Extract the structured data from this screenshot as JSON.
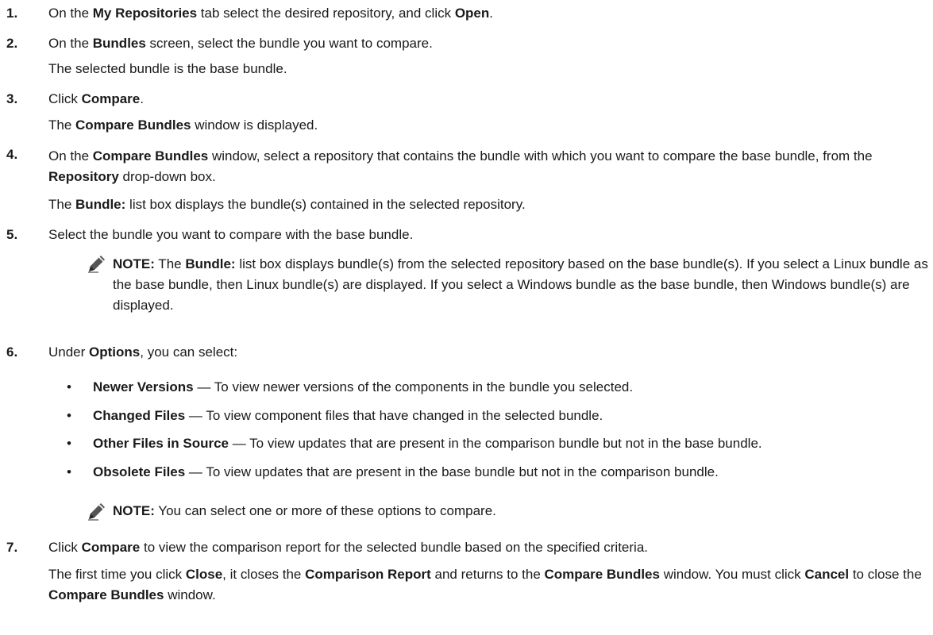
{
  "steps": [
    {
      "num": "1.",
      "parts": [
        "On the ",
        "My Repositories",
        " tab select the desired repository, and click ",
        "Open",
        "."
      ]
    },
    {
      "num": "2.",
      "parts": [
        "On the ",
        "Bundles",
        " screen, select the bundle you want to compare."
      ],
      "result": "The selected bundle is the base bundle."
    },
    {
      "num": "3.",
      "parts": [
        "Click ",
        "Compare",
        "."
      ],
      "result_parts": [
        "The ",
        "Compare Bundles",
        " window is displayed."
      ]
    },
    {
      "num": "4.",
      "parts": [
        "On the ",
        "Compare Bundles",
        " window, select a repository that contains the bundle with which you want to compare the base bundle, from the ",
        "Repository",
        " drop-down box."
      ],
      "result_parts": [
        "The ",
        "Bundle:",
        " list box displays the bundle(s) contained in the selected repository."
      ]
    },
    {
      "num": "5.",
      "parts": [
        "Select the bundle you want to compare with the base bundle."
      ]
    },
    {
      "num": "6.",
      "parts": [
        "Under ",
        "Options",
        ", you can select:"
      ]
    },
    {
      "num": "7.",
      "parts": [
        "Click ",
        "Compare",
        " to view the comparison report for the selected bundle based on the specified criteria."
      ],
      "result_parts": [
        "The first time you click ",
        "Close",
        ", it closes the ",
        "Comparison Report",
        " and returns to the ",
        "Compare Bundles",
        " window. You must click ",
        "Cancel",
        " to close the ",
        "Compare Bundles",
        " window."
      ]
    }
  ],
  "note1": {
    "label": "NOTE:",
    "parts": [
      " The ",
      "Bundle:",
      " list box displays bundle(s) from the selected repository based on the base bundle(s). If you select a Linux bundle as the base bundle, then Linux bundle(s) are displayed. If you select a Windows bundle as the base bundle, then Windows bundle(s) are displayed."
    ]
  },
  "options": [
    {
      "name": "Newer Versions",
      "desc": " — To view newer versions of the components in the bundle you selected."
    },
    {
      "name": "Changed Files",
      "desc": " — To view component files that have changed in the selected bundle."
    },
    {
      "name": "Other Files in Source",
      "desc": " — To view updates that are present in the comparison bundle but not in the base bundle."
    },
    {
      "name": "Obsolete Files",
      "desc": " — To view updates that are present in the base bundle but not in the comparison bundle."
    }
  ],
  "note2": {
    "label": "NOTE:",
    "text": " You can select one or more of these options to compare."
  },
  "icons": {
    "note": "pencil-note-icon",
    "bullet": "•"
  }
}
